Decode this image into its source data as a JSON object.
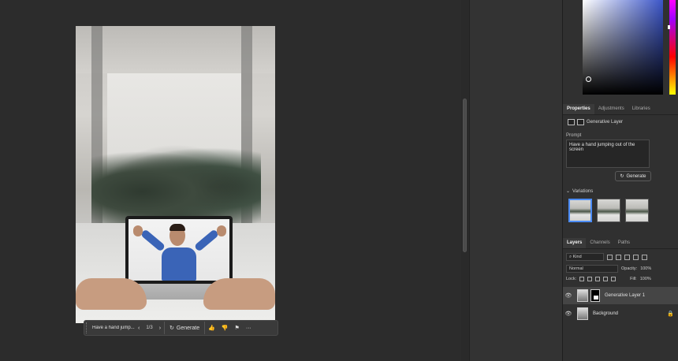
{
  "canvas": {
    "taskbar": {
      "prompt_preview": "Have a hand jump...",
      "prev_icon": "chevron-left-icon",
      "page_indicator": "1/3",
      "next_icon": "chevron-right-icon",
      "generate_label": "Generate",
      "thumbs_up_icon": "thumbs-up-icon",
      "thumbs_down_icon": "thumbs-down-icon",
      "flag_icon": "flag-icon",
      "more_icon": "more-icon"
    }
  },
  "properties": {
    "tabs": [
      "Properties",
      "Adjustments",
      "Libraries"
    ],
    "active_tab": "Properties",
    "layer_type": "Generative Layer",
    "prompt_label": "Prompt",
    "prompt_text": "Have a hand jumping out of the screen",
    "generate_label": "Generate",
    "variations_label": "Variations"
  },
  "layers": {
    "tabs": [
      "Layers",
      "Channels",
      "Paths"
    ],
    "active_tab": "Layers",
    "kind_filter": "Kind",
    "blend_mode": "Normal",
    "opacity_label": "Opacity:",
    "opacity_value": "100%",
    "lock_label": "Lock:",
    "fill_label": "Fill:",
    "fill_value": "100%",
    "items": [
      {
        "name": "Generative Layer 1",
        "selected": true
      },
      {
        "name": "Background",
        "selected": false
      }
    ]
  },
  "colors": {
    "accent": "#4c8cf5",
    "panel_bg": "#303030",
    "canvas_bg": "#2c2c2c"
  }
}
